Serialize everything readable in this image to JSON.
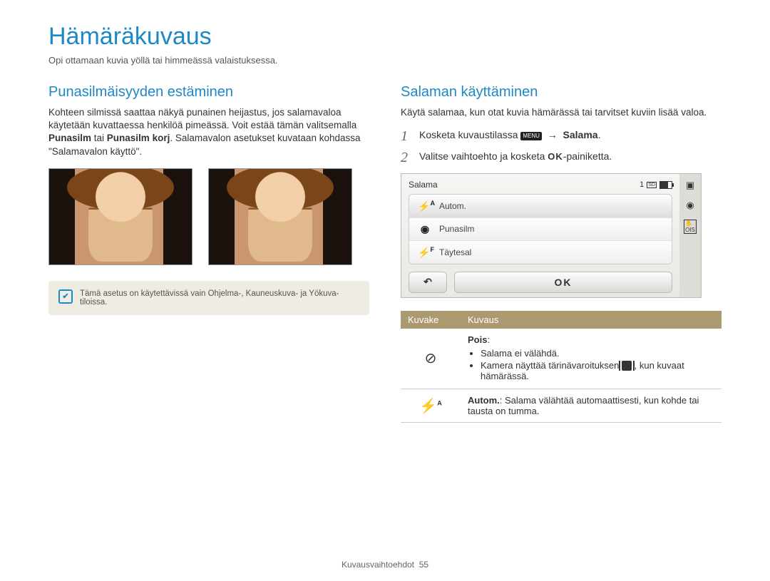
{
  "page": {
    "title": "Hämäräkuvaus",
    "subtitle": "Opi ottamaan kuvia yöllä tai himmeässä valaistuksessa."
  },
  "left": {
    "heading": "Punasilmäisyyden estäminen",
    "para_pre": "Kohteen silmissä saattaa näkyä punainen heijastus, jos salamavaloa käytetään kuvattaessa henkilöä pimeässä. Voit estää tämän valitsemalla ",
    "opt1": "Punasilm",
    "para_mid": " tai ",
    "opt2": "Punasilm korj",
    "para_post": ". Salamavalon asetukset kuvataan kohdassa \"Salamavalon käyttö\".",
    "note": "Tämä asetus on käytettävissä vain Ohjelma-, Kauneuskuva- ja Yökuva-tiloissa."
  },
  "right": {
    "heading": "Salaman käyttäminen",
    "intro": "Käytä salamaa, kun otat kuvia hämärässä tai tarvitset kuviin lisää valoa.",
    "step1_text": "Kosketa kuvaustilassa ",
    "step1_menu_label": "MENU",
    "step1_arrow": "→",
    "step1_target": "Salama",
    "step1_end": ".",
    "step2_pre": "Valitse vaihtoehto ja kosketa ",
    "step2_ok": "OK",
    "step2_post": "-painiketta.",
    "screen": {
      "title": "Salama",
      "count": "1",
      "card_label": "SD",
      "items": [
        {
          "label": "Autom."
        },
        {
          "label": "Punasilm"
        },
        {
          "label": "Täytesal"
        }
      ],
      "ok": "OK",
      "side": {
        "redeye": "◉",
        "ois": "OIS"
      }
    },
    "table": {
      "head_icon": "Kuvake",
      "head_desc": "Kuvaus",
      "rows": [
        {
          "icon": "⊘",
          "title": "Pois",
          "bullets": [
            "Salama ei välähdä.",
            "Kamera näyttää tärinävaroituksen ‑kuvakkeen, kun kuvaat hämärässä."
          ],
          "bullet2_pre": "Kamera näyttää tärinävaroituksen ",
          "bullet2_post": ", kun kuvaat hämärässä."
        },
        {
          "icon": "⚡A",
          "title": "Autom.",
          "desc": ": Salama välähtää automaattisesti, kun kohde tai tausta on tumma."
        }
      ]
    }
  },
  "footer": {
    "section": "Kuvausvaihtoehdot",
    "page": "55"
  }
}
